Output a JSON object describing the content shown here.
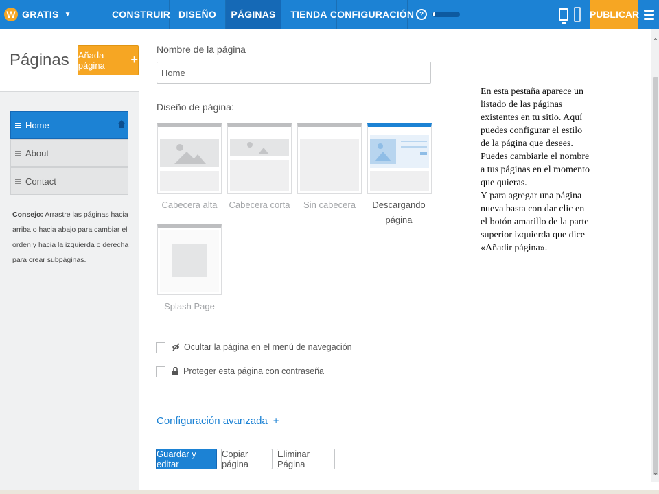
{
  "topbar": {
    "brand": "GRATIS",
    "nav": [
      {
        "label": "CONSTRUIR",
        "active": false
      },
      {
        "label": "DISEÑO",
        "active": false
      },
      {
        "label": "PÁGINAS",
        "active": true
      },
      {
        "label": "TIENDA",
        "active": false
      },
      {
        "label": "CONFIGURACIÓN",
        "active": false
      }
    ],
    "help": "?",
    "progress_fraction": 0.08,
    "publish": "PUBLICAR",
    "colors": {
      "bar": "#1c82d4",
      "active_tab": "#1569b6",
      "publish": "#f6a623"
    }
  },
  "sidebar": {
    "title": "Páginas",
    "add_button": "Añada página",
    "add_plus": "+",
    "pages": [
      {
        "label": "Home",
        "active": true
      },
      {
        "label": "About",
        "active": false
      },
      {
        "label": "Contact",
        "active": false
      }
    ],
    "tip_label": "Consejo:",
    "tip_text": "Arrastre las páginas hacia arriba o hacia abajo para cambiar el orden y hacia la izquierda o derecha para crear subpáginas."
  },
  "main": {
    "name_label": "Nombre de la página",
    "name_value": "Home",
    "layout_label": "Diseño de página:",
    "layouts": [
      {
        "label": "Cabecera alta",
        "selected": false
      },
      {
        "label": "Cabecera corta",
        "selected": false
      },
      {
        "label": "Sin cabecera",
        "selected": false
      },
      {
        "label": "Descargando página",
        "selected": true
      },
      {
        "label": "Splash Page",
        "selected": false
      }
    ],
    "hide_label": "Ocultar la página en el menú de navegación",
    "protect_label": "Proteger esta página con contraseña",
    "advanced": "Configuración avanzada",
    "advanced_plus": "+",
    "save_button": "Guardar y editar",
    "copy_button": "Copiar página",
    "delete_button": "Eliminar Página"
  },
  "note": {
    "p1": "En esta pestaña aparece un listado de las páginas existentes en tu sitio. Aquí puedes configurar el estilo de la página que desees.",
    "p2": "Puedes cambiarle el nombre a tus páginas en el momento que quieras.",
    "p3": "Y para agregar una página nueva basta con dar clic en el botón amarillo de la parte superior izquierda que dice «Añadir página»."
  }
}
